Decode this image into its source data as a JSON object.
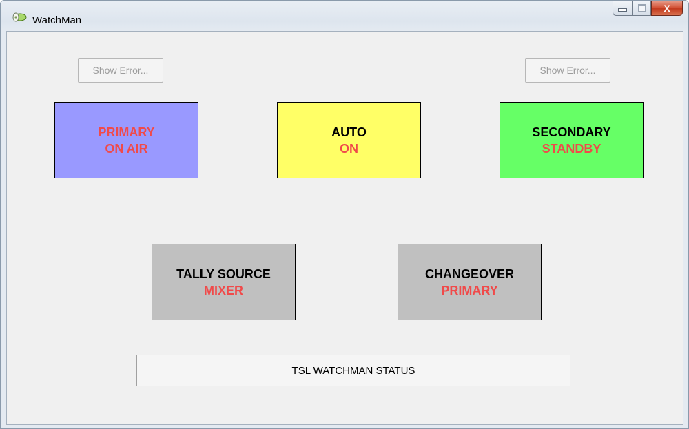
{
  "window": {
    "title": "WatchMan",
    "icon": "watchman-app-icon",
    "buttons": {
      "minimize": "minimize-icon",
      "maximize": "maximize-icon",
      "close": "X"
    }
  },
  "error_buttons": {
    "left_label": "Show Error...",
    "right_label": "Show Error..."
  },
  "status_boxes": {
    "primary": {
      "title": "PRIMARY",
      "value": "ON AIR",
      "color": "#9999ff",
      "title_color": "#f04a4a"
    },
    "auto": {
      "title": "AUTO",
      "value": "ON",
      "color": "#ffff66",
      "title_color": "#000000"
    },
    "secondary": {
      "title": "SECONDARY",
      "value": "STANDBY",
      "color": "#66ff66",
      "title_color": "#000000"
    },
    "tally": {
      "title": "TALLY SOURCE",
      "value": "MIXER",
      "color": "#c0c0c0",
      "title_color": "#000000"
    },
    "changeover": {
      "title": "CHANGEOVER",
      "value": "PRIMARY",
      "color": "#c0c0c0",
      "title_color": "#000000"
    }
  },
  "status_bar": {
    "text": "TSL WATCHMAN STATUS"
  },
  "colors": {
    "value_text": "#f04a4a",
    "client_bg": "#f0f0f0"
  }
}
